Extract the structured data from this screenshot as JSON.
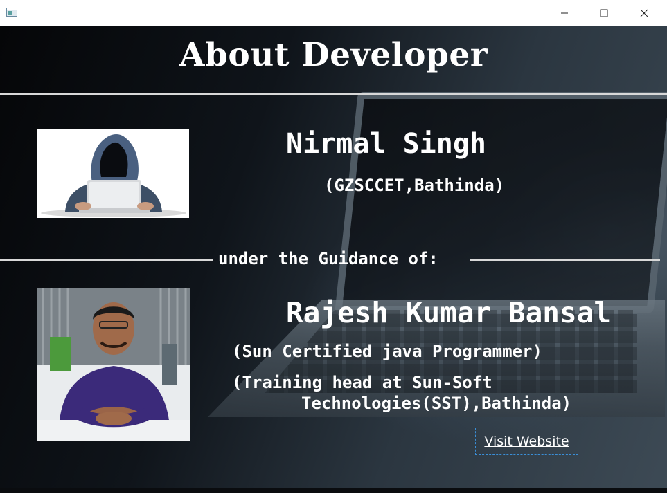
{
  "window": {
    "icons": {
      "app": "window-icon",
      "minimize": "minimize-icon",
      "maximize": "maximize-icon",
      "close": "close-icon"
    }
  },
  "page": {
    "title": "About Developer",
    "developer": {
      "name": "Nirmal Singh",
      "college": "(GZSCCET,Bathinda)"
    },
    "guidance_label": "under the Guidance of:",
    "guide": {
      "name": "Rajesh Kumar Bansal",
      "certification": "(Sun Certified java Programmer)",
      "role_line1": "(Training head at Sun-Soft",
      "role_line2": "Technologies(SST),Bathinda)"
    },
    "visit_link": "Visit Website"
  },
  "colors": {
    "text": "#ffffff",
    "link_focus_border": "#3a8fd8",
    "divider": "#d8d8d8"
  }
}
